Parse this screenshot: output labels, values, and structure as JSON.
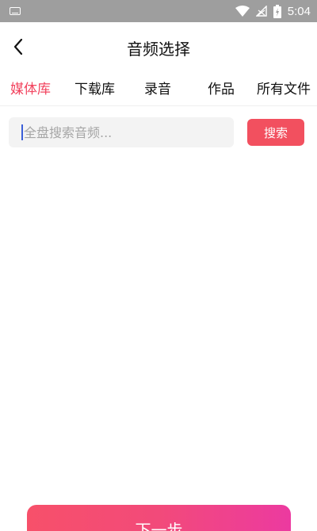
{
  "status_bar": {
    "time": "5:04",
    "icons": [
      "keyboard-icon",
      "wifi-icon",
      "no-signal-icon",
      "battery-charging-icon"
    ]
  },
  "header": {
    "title": "音频选择",
    "back_icon": "chevron-left-icon"
  },
  "tabs": [
    {
      "label": "媒体库",
      "active": true
    },
    {
      "label": "下载库",
      "active": false
    },
    {
      "label": "录音",
      "active": false
    },
    {
      "label": "作品",
      "active": false
    },
    {
      "label": "所有文件",
      "active": false
    }
  ],
  "search": {
    "placeholder": "全盘搜索音频...",
    "value": "",
    "button_label": "搜索"
  },
  "footer": {
    "next_label": "下一步"
  },
  "colors": {
    "accent": "#f2435e",
    "search_button": "#f2505f",
    "status_bar": "#9e9e9e",
    "next_gradient_start": "#f7506a",
    "next_gradient_end": "#ec3aa0"
  }
}
